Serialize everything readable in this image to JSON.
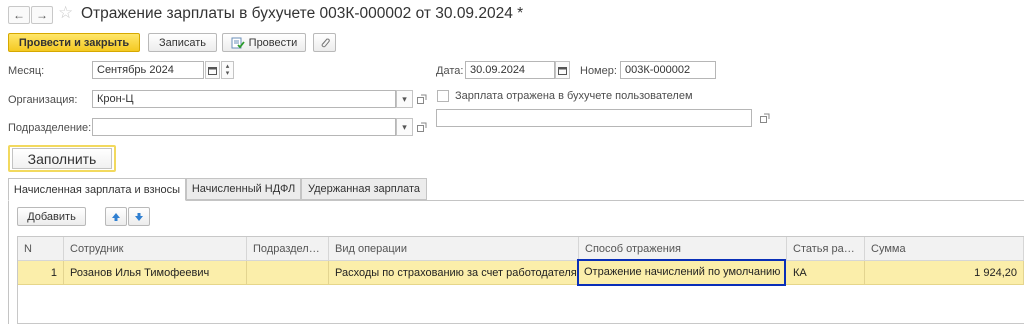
{
  "header": {
    "back_icon": "←",
    "forward_icon": "→",
    "favorite_icon": "☆",
    "title": "Отражение зарплаты в бухучете 003К-000002 от 30.09.2024 *"
  },
  "toolbar": {
    "post_close_label": "Провести и закрыть",
    "save_label": "Записать",
    "post_label": "Провести",
    "attach_icon": "clip-icon"
  },
  "form": {
    "month_label": "Месяц:",
    "month_value": "Сентябрь 2024",
    "org_label": "Организация:",
    "org_value": "Крон-Ц",
    "dept_label": "Подразделение:",
    "dept_value": "",
    "date_label": "Дата:",
    "date_value": "30.09.2024",
    "number_label": "Номер:",
    "number_value": "003К-000002",
    "user_reflected_label": "Зарплата отражена в бухучете пользователем",
    "user_reflected_checked": false,
    "user_reflected_value": ""
  },
  "fill_label": "Заполнить",
  "tabs": [
    {
      "label": "Начисленная зарплата и взносы",
      "active": true
    },
    {
      "label": "Начисленный НДФЛ",
      "active": false
    },
    {
      "label": "Удержанная зарплата",
      "active": false
    }
  ],
  "table_toolbar": {
    "add_label": "Добавить",
    "up_icon": "🡅",
    "down_icon": "🡇"
  },
  "table": {
    "columns": [
      "N",
      "Сотрудник",
      "Подразделе...",
      "Вид операции",
      "Способ отражения",
      "Статья расх...",
      "Сумма"
    ],
    "rows": [
      {
        "n": "1",
        "employee": "Розанов Илья Тимофеевич",
        "department": "",
        "operation": "Расходы по страхованию за счет работодателя",
        "method": "Отражение начислений по умолчанию",
        "expense": "КА",
        "amount": "1 924,20"
      }
    ]
  },
  "colors": {
    "primary_button": "#f4c922",
    "selected_row": "#fbeeaa",
    "focus_border": "#0a2fb8"
  }
}
